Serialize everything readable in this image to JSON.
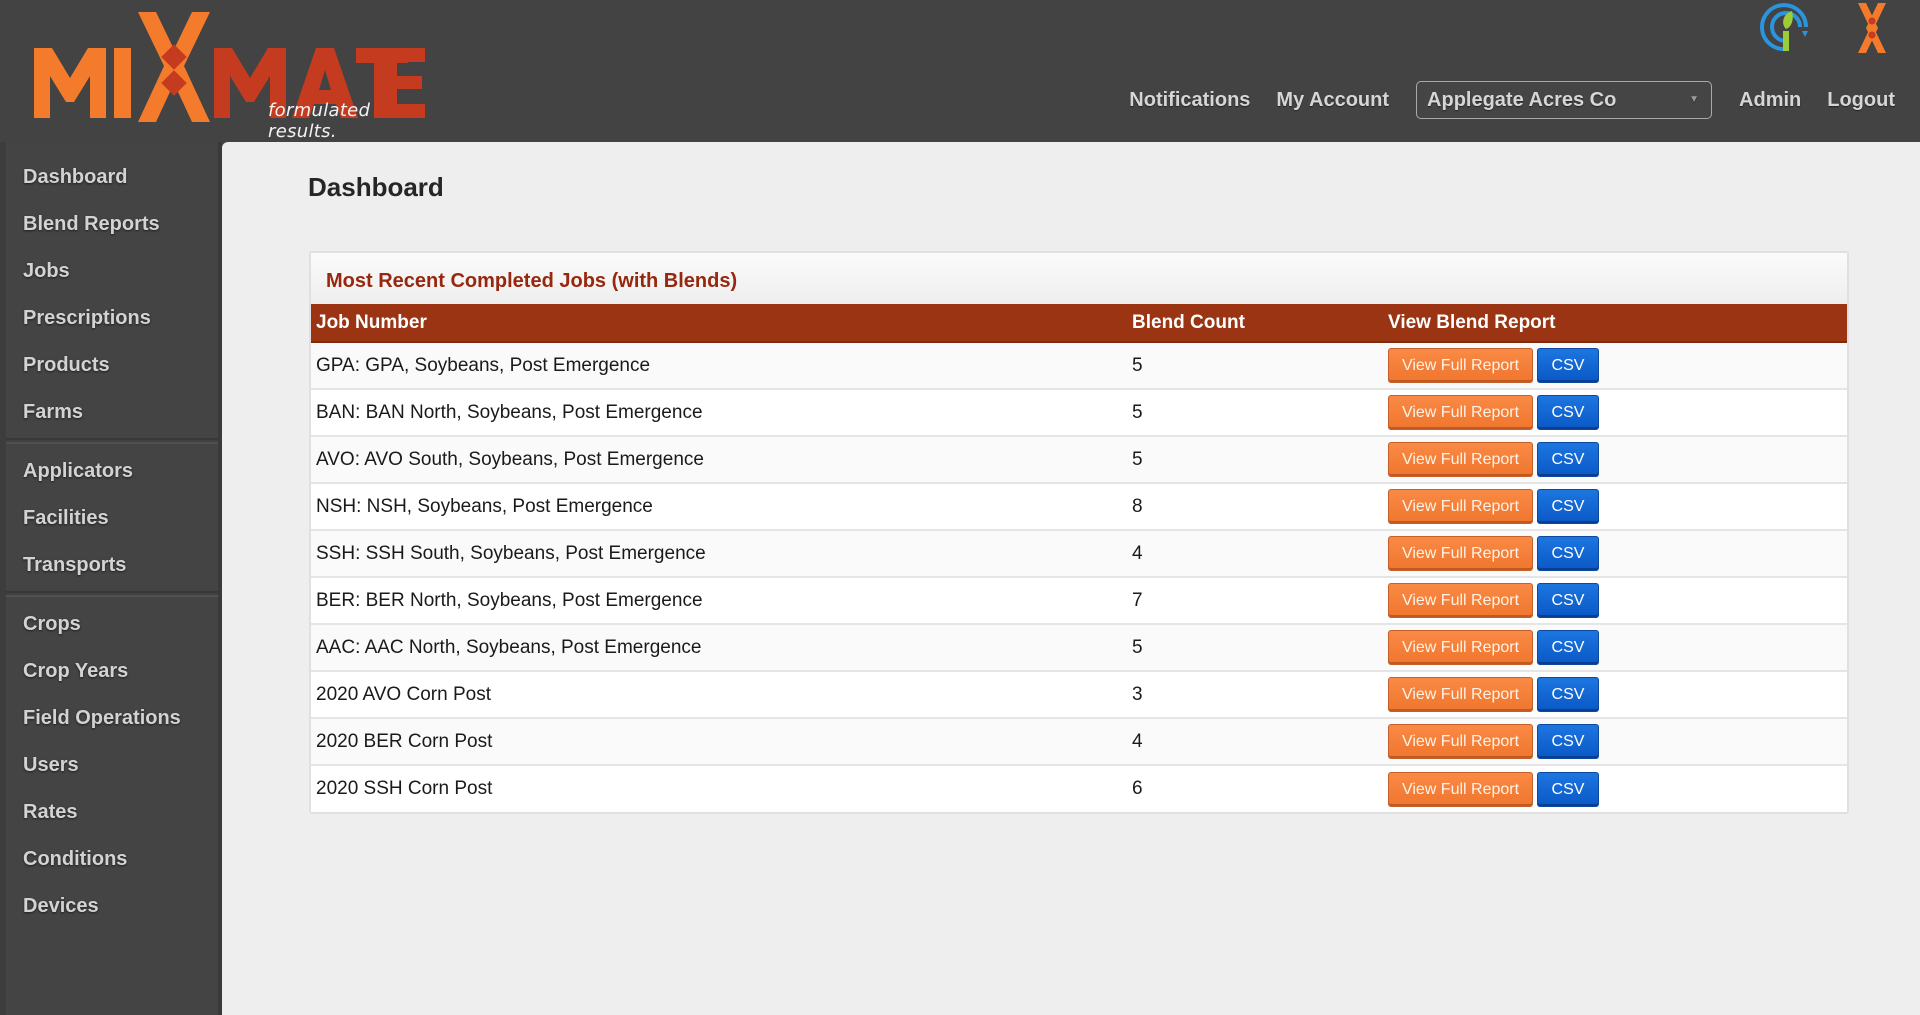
{
  "brand": {
    "logo_left": "MI",
    "logo_right": "MATE",
    "tagline": "formulated results.",
    "colors": {
      "orange": "#f47b2c",
      "red": "#c43b1f",
      "header_bg": "#434343",
      "table_header": "#9b3413",
      "panel_title": "#97280f",
      "button_orange": "#f47d35",
      "button_blue": "#0d62d2"
    }
  },
  "header": {
    "nav": {
      "notifications": "Notifications",
      "my_account": "My Account",
      "organization_selected": "Applegate Acres Co",
      "admin": "Admin",
      "logout": "Logout"
    },
    "icons": [
      "signal-leaf-app-icon",
      "mixmate-x-app-icon"
    ]
  },
  "sidebar": {
    "groups": [
      {
        "items": [
          {
            "label": "Dashboard"
          },
          {
            "label": "Blend Reports"
          },
          {
            "label": "Jobs"
          },
          {
            "label": "Prescriptions"
          },
          {
            "label": "Products"
          },
          {
            "label": "Farms"
          }
        ]
      },
      {
        "items": [
          {
            "label": "Applicators"
          },
          {
            "label": "Facilities"
          },
          {
            "label": "Transports"
          }
        ]
      },
      {
        "items": [
          {
            "label": "Crops"
          },
          {
            "label": "Crop Years"
          },
          {
            "label": "Field Operations"
          },
          {
            "label": "Users"
          },
          {
            "label": "Rates"
          },
          {
            "label": "Conditions"
          },
          {
            "label": "Devices"
          }
        ]
      }
    ]
  },
  "main": {
    "page_title": "Dashboard",
    "panel": {
      "title": "Most Recent Completed Jobs (with Blends)",
      "columns": [
        "Job Number",
        "Blend Count",
        "View Blend Report"
      ],
      "view_button_label": "View Full Report",
      "csv_button_label": "CSV",
      "rows": [
        {
          "job": "GPA: GPA, Soybeans, Post Emergence",
          "count": "5"
        },
        {
          "job": "BAN: BAN North, Soybeans, Post Emergence",
          "count": "5"
        },
        {
          "job": "AVO: AVO South, Soybeans, Post Emergence",
          "count": "5"
        },
        {
          "job": "NSH: NSH, Soybeans, Post Emergence",
          "count": "8"
        },
        {
          "job": "SSH: SSH South, Soybeans, Post Emergence",
          "count": "4"
        },
        {
          "job": "BER: BER North, Soybeans, Post Emergence",
          "count": "7"
        },
        {
          "job": "AAC: AAC North, Soybeans, Post Emergence",
          "count": "5"
        },
        {
          "job": "2020 AVO Corn Post",
          "count": "3"
        },
        {
          "job": "2020 BER Corn Post",
          "count": "4"
        },
        {
          "job": "2020 SSH Corn Post",
          "count": "6"
        }
      ]
    }
  }
}
